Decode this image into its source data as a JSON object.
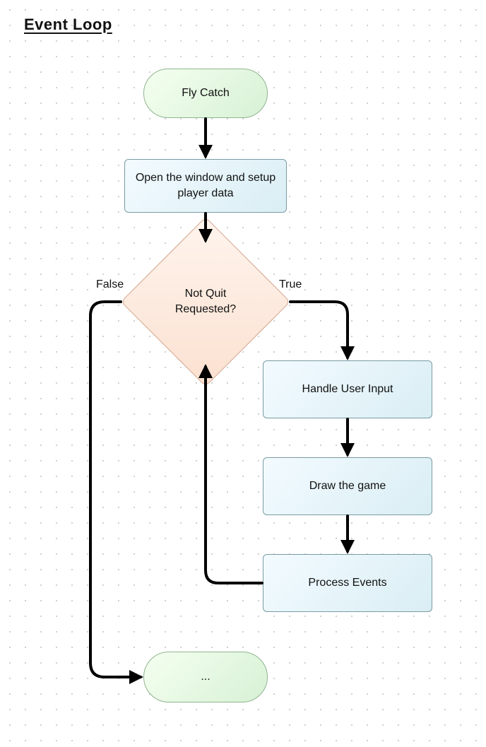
{
  "title": "Event Loop",
  "nodes": {
    "start": {
      "label": "Fly Catch"
    },
    "setup": {
      "label": "Open the window and setup player data"
    },
    "decision": {
      "label": "Not Quit Requested?"
    },
    "handle_input": {
      "label": "Handle User Input"
    },
    "draw": {
      "label": "Draw the game"
    },
    "process": {
      "label": "Process Events"
    },
    "end": {
      "label": "..."
    }
  },
  "edges": {
    "false_label": "False",
    "true_label": "True"
  }
}
